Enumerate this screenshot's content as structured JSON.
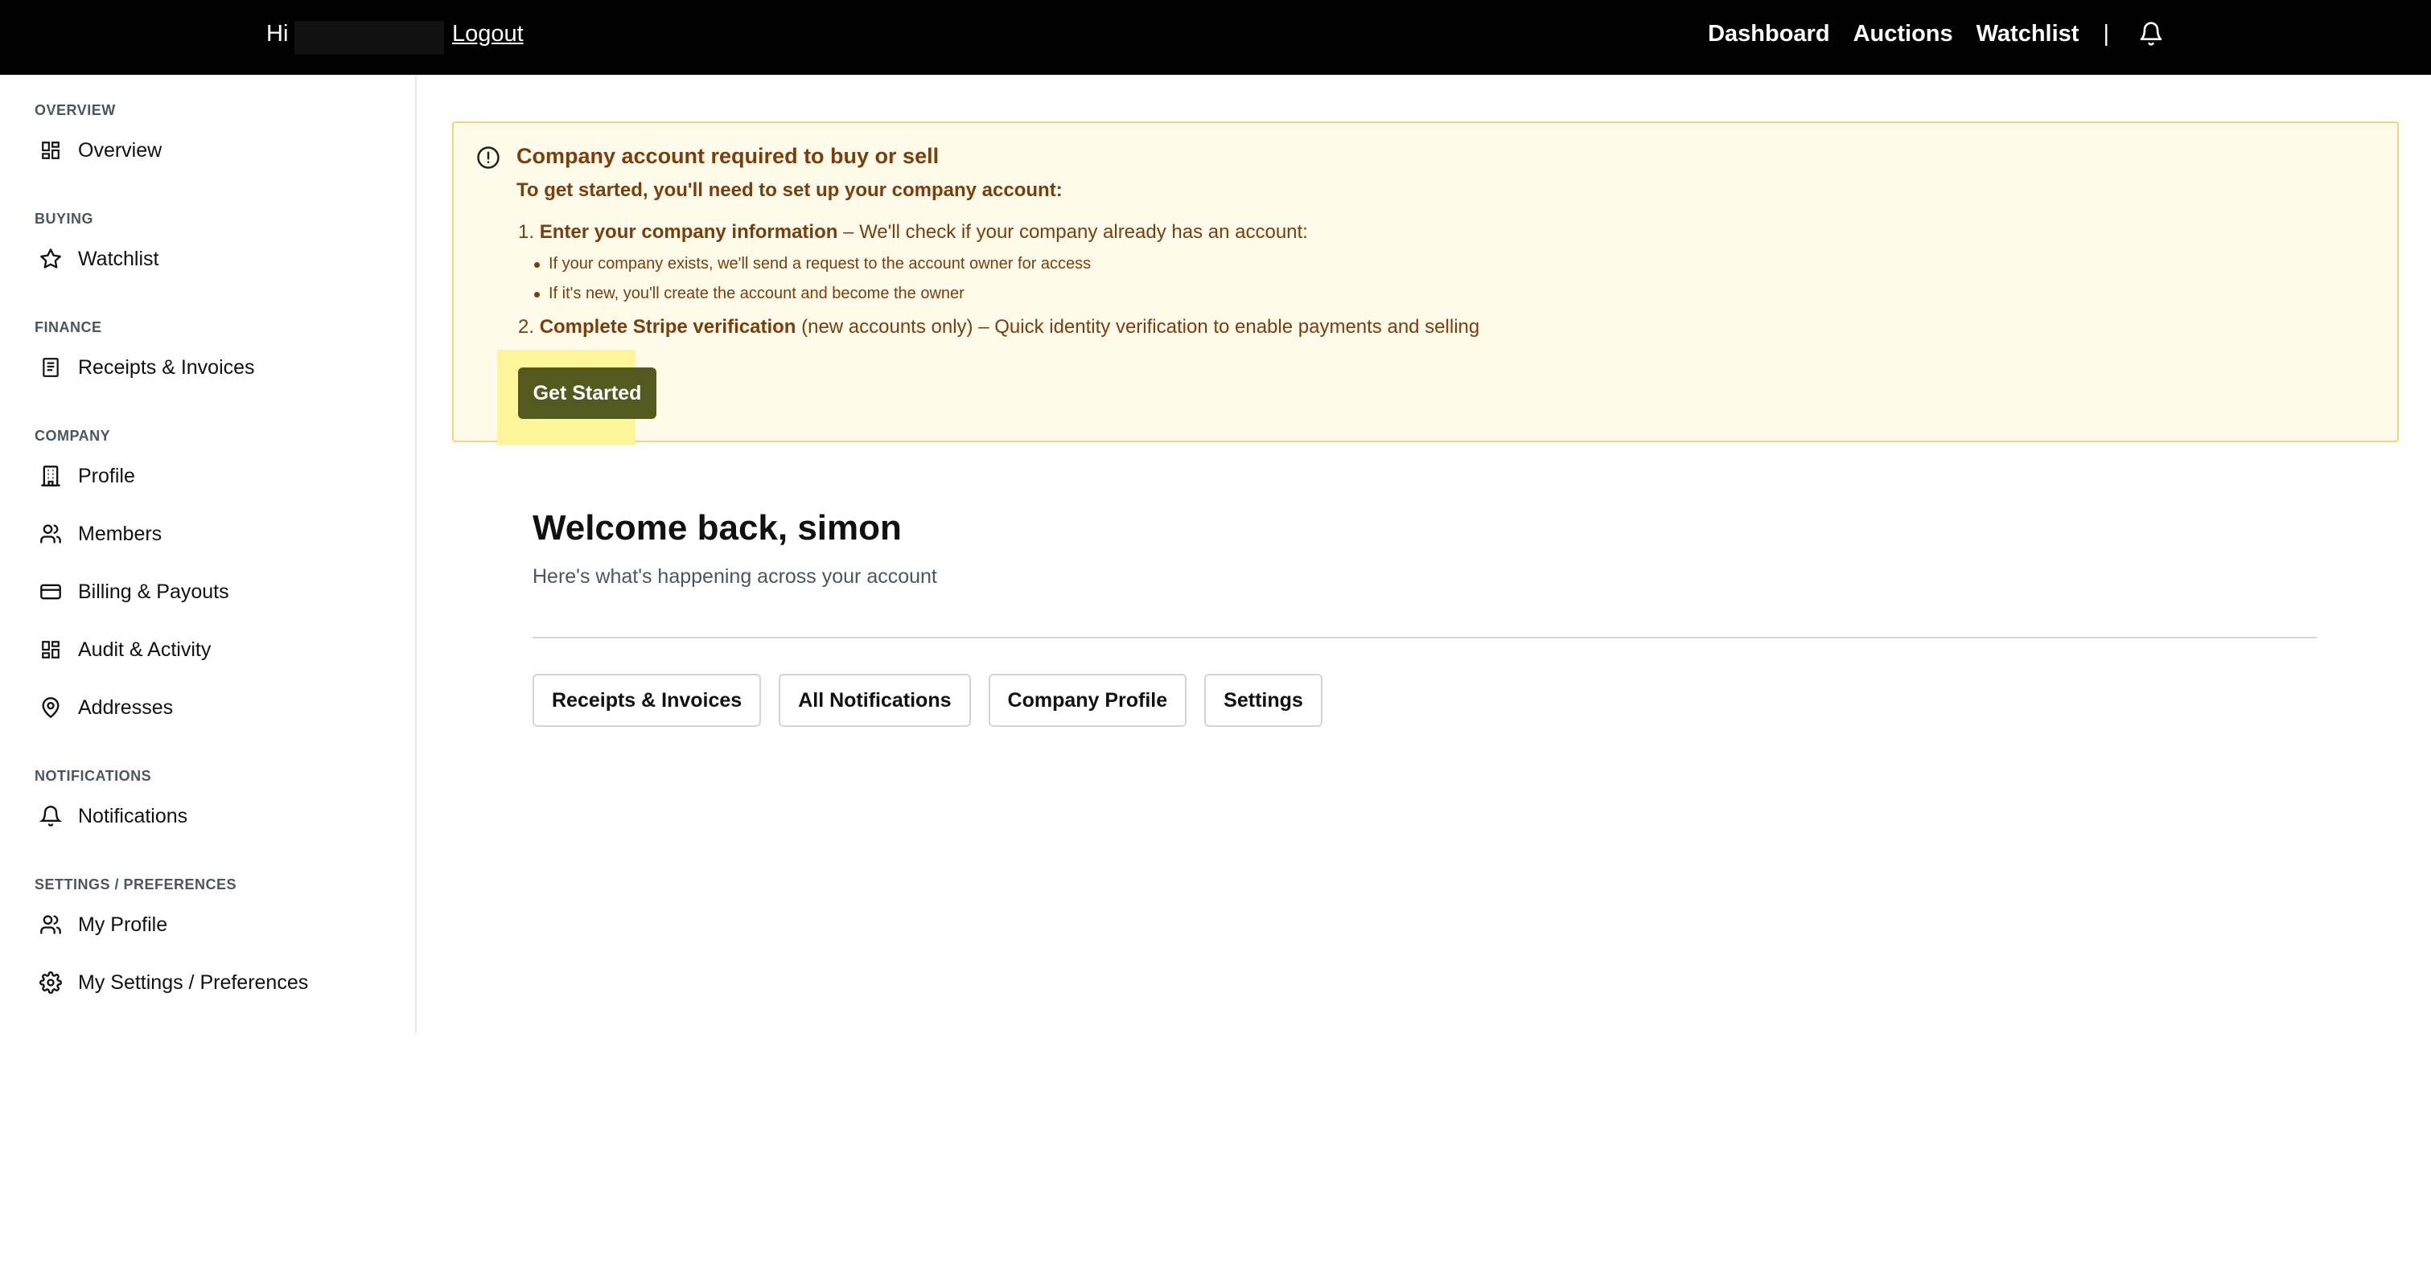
{
  "topbar": {
    "greeting": "Hi",
    "logout_label": "Logout",
    "nav": [
      "Dashboard",
      "Auctions",
      "Watchlist"
    ],
    "separator": "|"
  },
  "sidebar": {
    "sections": [
      {
        "title": "OVERVIEW",
        "items": [
          {
            "label": "Overview",
            "icon": "grid-icon"
          }
        ]
      },
      {
        "title": "BUYING",
        "items": [
          {
            "label": "Watchlist",
            "icon": "star-icon"
          }
        ]
      },
      {
        "title": "FINANCE",
        "items": [
          {
            "label": "Receipts & Invoices",
            "icon": "receipt-icon"
          }
        ]
      },
      {
        "title": "COMPANY",
        "items": [
          {
            "label": "Profile",
            "icon": "building-icon"
          },
          {
            "label": "Members",
            "icon": "users-icon"
          },
          {
            "label": "Billing & Payouts",
            "icon": "credit-card-icon"
          },
          {
            "label": "Audit & Activity",
            "icon": "grid-icon"
          },
          {
            "label": "Addresses",
            "icon": "map-pin-icon"
          }
        ]
      },
      {
        "title": "NOTIFICATIONS",
        "items": [
          {
            "label": "Notifications",
            "icon": "bell-icon"
          }
        ]
      },
      {
        "title": "SETTINGS / PREFERENCES",
        "items": [
          {
            "label": "My Profile",
            "icon": "users-icon"
          },
          {
            "label": "My Settings / Preferences",
            "icon": "gear-icon"
          }
        ]
      }
    ]
  },
  "alert": {
    "title": "Company account required to buy or sell",
    "subtitle": "To get started, you'll need to set up your company account:",
    "step1_num": "1.",
    "step1_bold": "Enter your company information",
    "step1_rest": " – We'll check if your company already has an account:",
    "bullet1": "If your company exists, we'll send a request to the account owner for access",
    "bullet2": "If it's new, you'll create the account and become the owner",
    "step2_num": "2.",
    "step2_bold": "Complete Stripe verification",
    "step2_rest": " (new accounts only) – Quick identity verification to enable payments and selling",
    "button_label": "Get Started"
  },
  "main": {
    "welcome": "Welcome back, simon",
    "welcome_sub": "Here's what's happening across your account",
    "quick_links": [
      "Receipts & Invoices",
      "All Notifications",
      "Company Profile",
      "Settings"
    ]
  }
}
